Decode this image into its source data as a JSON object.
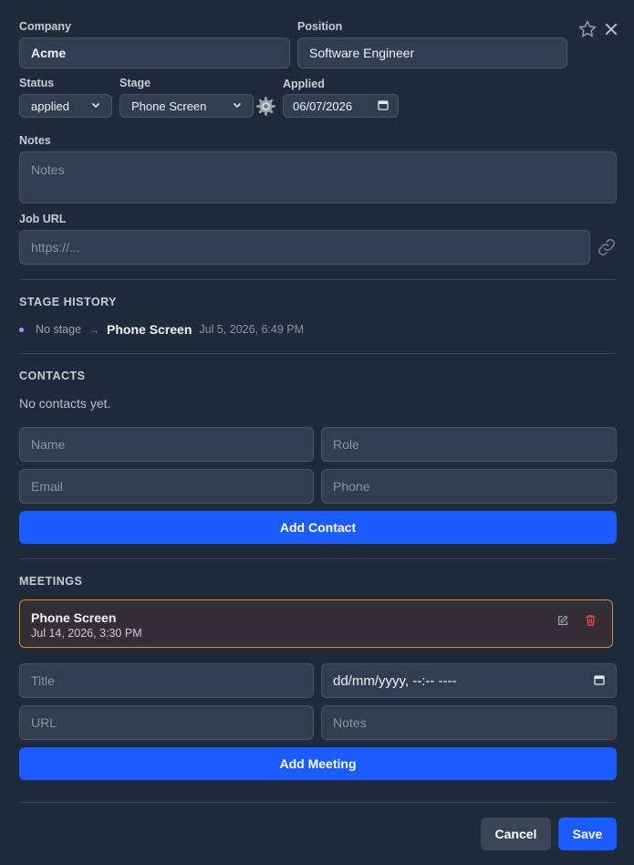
{
  "form": {
    "company_label": "Company",
    "company_value": "Acme",
    "position_label": "Position",
    "position_value": "Software Engineer",
    "status_label": "Status",
    "status_value": "applied",
    "stage_label": "Stage",
    "stage_value": "Phone Screen",
    "applied_label": "Applied",
    "applied_value": "06/07/2026",
    "notes_label": "Notes",
    "notes_placeholder": "Notes",
    "job_url_label": "Job URL",
    "job_url_placeholder": "https://..."
  },
  "stage_history": {
    "title": "STAGE HISTORY",
    "entries": [
      {
        "from": "No stage",
        "to": "Phone Screen",
        "time": "Jul 5, 2026, 6:49 PM",
        "dot_color": "#c084fc"
      }
    ]
  },
  "contacts": {
    "title": "CONTACTS",
    "empty_text": "No contacts yet.",
    "name_placeholder": "Name",
    "role_placeholder": "Role",
    "email_placeholder": "Email",
    "phone_placeholder": "Phone",
    "add_label": "Add Contact"
  },
  "meetings": {
    "title": "MEETINGS",
    "items": [
      {
        "title": "Phone Screen",
        "time": "Jul 14, 2026, 3:30 PM"
      }
    ],
    "title_placeholder": "Title",
    "datetime_placeholder": "dd/mm/yyyy, --:-- ----",
    "url_placeholder": "URL",
    "notes_placeholder": "Notes",
    "add_label": "Add Meeting"
  },
  "footer": {
    "cancel_label": "Cancel",
    "save_label": "Save"
  },
  "colors": {
    "background": "#1f2a3b",
    "primary": "#1a5cff",
    "meeting_border": "#e08a2c",
    "delete": "#ef4444"
  }
}
